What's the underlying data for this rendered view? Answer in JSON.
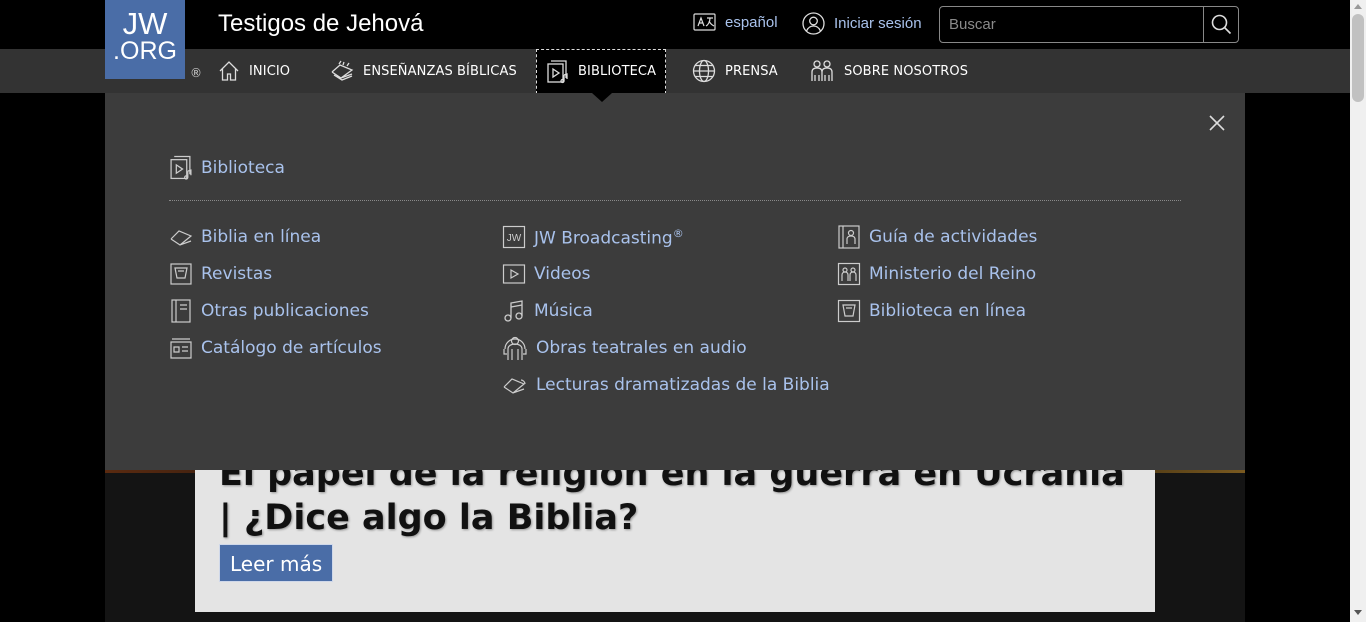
{
  "header": {
    "logo_line1": "JW",
    "logo_line2": ".ORG",
    "registered": "®",
    "site_title": "Testigos de Jehová",
    "language_label": "español",
    "login_label": "Iniciar sesión",
    "search_placeholder": "Buscar"
  },
  "nav": {
    "items": [
      {
        "label": "INICIO",
        "icon": "home-icon"
      },
      {
        "label": "ENSEÑANZAS BÍBLICAS",
        "icon": "bible-icon"
      },
      {
        "label": "BIBLIOTECA",
        "icon": "library-icon",
        "active": true
      },
      {
        "label": "PRENSA",
        "icon": "globe-icon"
      },
      {
        "label": "SOBRE NOSOTROS",
        "icon": "people-icon"
      }
    ]
  },
  "menu": {
    "heading": "Biblioteca",
    "col1": [
      "Biblia en línea",
      "Revistas",
      "Otras publicaciones",
      "Catálogo de artículos"
    ],
    "col2": [
      "JW Broadcasting",
      "Videos",
      "Música",
      "Obras teatrales en audio",
      "Lecturas dramatizadas de la Biblia"
    ],
    "col2_sup": "®",
    "col3": [
      "Guía de actividades",
      "Ministerio del Reino",
      "Biblioteca en línea"
    ]
  },
  "hero": {
    "title": "El papel de la religión en la guerra en Ucrania | ¿Dice algo la Biblia?",
    "button": "Leer más"
  },
  "colors": {
    "accent_blue": "#4a6da7",
    "link_blue": "#a9c2ec",
    "nav_bg": "#333333",
    "panel_bg": "#3c3c3c"
  }
}
